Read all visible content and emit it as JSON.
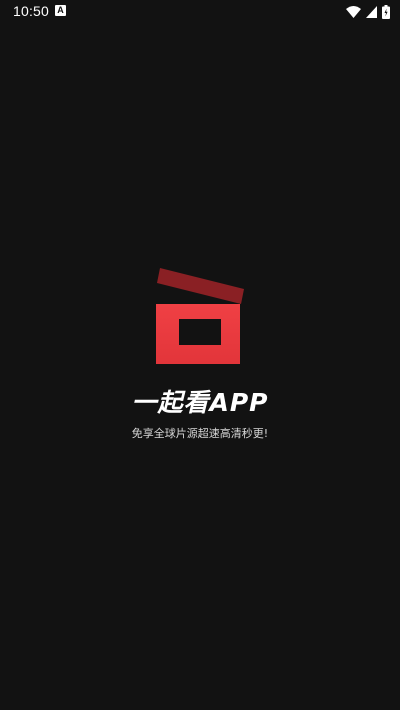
{
  "status_bar": {
    "time": "10:50",
    "notification_badge": "A",
    "icons": [
      "wifi-icon",
      "cellular-signal-icon",
      "battery-icon"
    ]
  },
  "splash": {
    "logo_icon": "clapperboard-icon",
    "title": "一起看APP",
    "subtitle": "免享全球片源超速高清秒更!"
  },
  "colors": {
    "background": "#121212",
    "logo_red": "#e8383d",
    "logo_dark_red": "#8a2024",
    "text_primary": "#ffffff"
  }
}
